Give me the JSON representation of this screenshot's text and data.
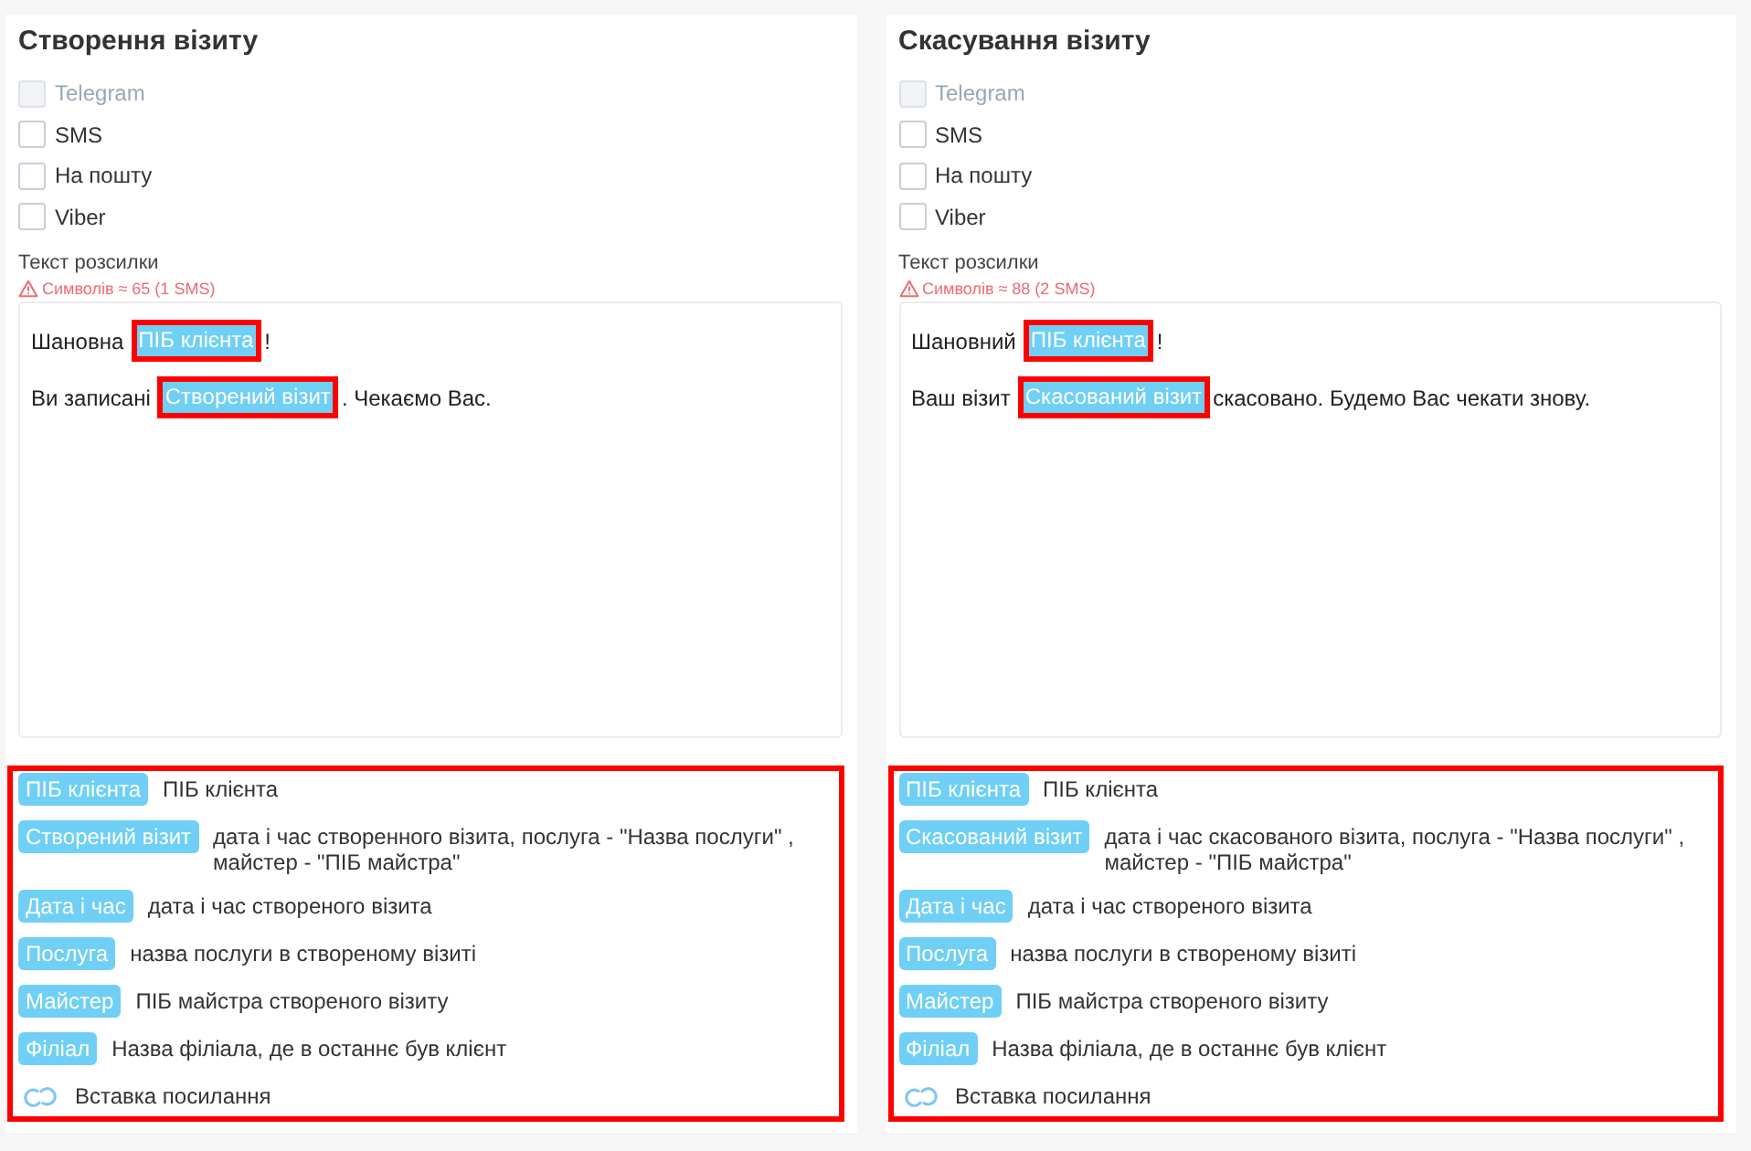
{
  "panels": [
    {
      "title": "Створення візиту",
      "channels": [
        {
          "label": "Telegram",
          "checked": false,
          "disabled": true
        },
        {
          "label": "SMS",
          "checked": false,
          "disabled": false
        },
        {
          "label": "На пошту",
          "checked": false,
          "disabled": false
        },
        {
          "label": "Viber",
          "checked": false,
          "disabled": false
        }
      ],
      "message_label": "Текст розсилки",
      "char_count": "Символів ≈ 65 (1 SMS)",
      "message": [
        [
          {
            "kind": "text",
            "text": "Шановна"
          },
          {
            "kind": "token",
            "text": "ПІБ клієнта",
            "highlighted": true
          },
          {
            "kind": "text",
            "text": "!"
          }
        ],
        [
          {
            "kind": "text",
            "text": "Ви записані"
          },
          {
            "kind": "token",
            "text": "Створений візит",
            "highlighted": true
          },
          {
            "kind": "text",
            "text": ". Чекаємо Вас."
          }
        ]
      ],
      "variables_highlighted": true,
      "variables": [
        {
          "token": "ПІБ клієнта",
          "description": "ПІБ клієнта"
        },
        {
          "token": "Створений візит",
          "description": "дата і час створенного візита, послуга - \"Назва послуги\" , майстер - \"ПІБ майстра\""
        },
        {
          "token": "Дата і час",
          "description": "дата і час створеного візита"
        },
        {
          "token": "Послуга",
          "description": "назва послуги в створеному візиті"
        },
        {
          "token": "Майстер",
          "description": "ПІБ майстра створеного візиту"
        },
        {
          "token": "Філіал",
          "description": "Назва філіала, де в останнє був клієнт"
        }
      ],
      "link": "Вставка посилання"
    },
    {
      "title": "Скасування візиту",
      "channels": [
        {
          "label": "Telegram",
          "checked": false,
          "disabled": true
        },
        {
          "label": "SMS",
          "checked": false,
          "disabled": false
        },
        {
          "label": "На пошту",
          "checked": false,
          "disabled": false
        },
        {
          "label": "Viber",
          "checked": false,
          "disabled": false
        }
      ],
      "message_label": "Текст розсилки",
      "char_count": "Символів ≈ 88 (2 SMS)",
      "message": [
        [
          {
            "kind": "text",
            "text": "Шановний"
          },
          {
            "kind": "token",
            "text": "ПІБ клієнта",
            "highlighted": true
          },
          {
            "kind": "text",
            "text": "!"
          }
        ],
        [
          {
            "kind": "text",
            "text": "Ваш візит"
          },
          {
            "kind": "token",
            "text": "Скасований візит",
            "highlighted": true
          },
          {
            "kind": "text",
            "text": "скасовано. Будемо Вас чекати знову."
          }
        ]
      ],
      "variables_highlighted": true,
      "variables": [
        {
          "token": "ПІБ клієнта",
          "description": "ПІБ клієнта"
        },
        {
          "token": "Скасований візит",
          "description": "дата і час скасованого візита, послуга - \"Назва послуги\" , майстер - \"ПІБ майстра\""
        },
        {
          "token": "Дата і час",
          "description": "дата і час створеного візита"
        },
        {
          "token": "Послуга",
          "description": "назва послуги в створеному візиті"
        },
        {
          "token": "Майстер",
          "description": "ПІБ майстра створеного візиту"
        },
        {
          "token": "Філіал",
          "description": "Назва філіала, де в останнє був клієнт"
        }
      ],
      "link": "Вставка посилання"
    }
  ]
}
